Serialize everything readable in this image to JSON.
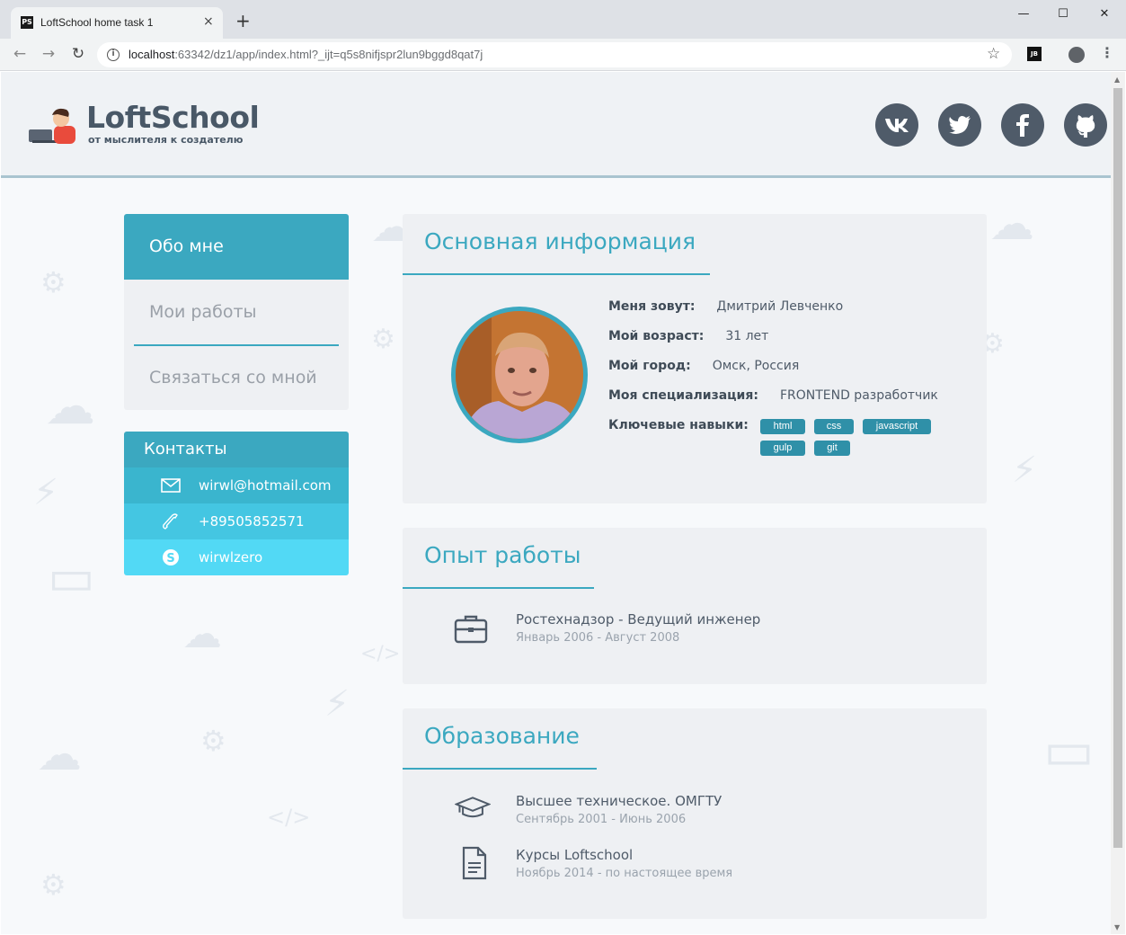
{
  "browser": {
    "tab_title": "LoftSchool home task 1",
    "tab_favicon": "PS",
    "tab_close": "×",
    "new_tab": "+",
    "window_minimize": "—",
    "window_maximize": "☐",
    "window_close": "✕",
    "url_host": "localhost",
    "url_rest": ":63342/dz1/app/index.html?_ijt=q5s8nifjspr2lun9bggd8qat7j",
    "extension_label": "JB"
  },
  "header": {
    "logo_title": "LoftSchool",
    "logo_subtitle": "от мыслителя к создателю",
    "social": [
      "vk-icon",
      "twitter-icon",
      "facebook-icon",
      "github-icon"
    ]
  },
  "menu": {
    "items": [
      "Обо мне",
      "Мои работы",
      "Связаться со мной"
    ],
    "active": 0
  },
  "contacts": {
    "title": "Контакты",
    "email": "wirwl@hotmail.com",
    "phone": "+89505852571",
    "skype": "wirwlzero",
    "row_colors": [
      "#3ab5ce",
      "#44c6e2",
      "#52d9f5"
    ]
  },
  "main_info": {
    "title": "Основная информация",
    "name_label": "Меня зовут:",
    "name": "Дмитрий Левченко",
    "age_label": "Мой возраст:",
    "age": "31 лет",
    "city_label": "Мой город:",
    "city": "Омск, Россия",
    "spec_label": "Моя специализация:",
    "spec": "FRONTEND разработчик",
    "skills_label": "Ключевые навыки:",
    "skills": [
      "html",
      "css",
      "javascript",
      "gulp",
      "git"
    ]
  },
  "experience": {
    "title": "Опыт работы",
    "items": [
      {
        "title": "Ростехнадзор - Ведущий инженер",
        "dates": "Январь 2006 - Август 2008",
        "icon": "briefcase-icon"
      }
    ]
  },
  "education": {
    "title": "Образование",
    "items": [
      {
        "title": "Высшее техническое. ОМГТУ",
        "dates": "Сентябрь 2001 - Июнь 2006",
        "icon": "graduation-cap-icon"
      },
      {
        "title": "Курсы Loftschool",
        "dates": "Ноябрь 2014 - по настоящее время",
        "icon": "document-icon"
      }
    ]
  },
  "colors": {
    "accent": "#3ba8c0",
    "dark": "#4f5b69",
    "card_bg": "#eef0f3"
  }
}
